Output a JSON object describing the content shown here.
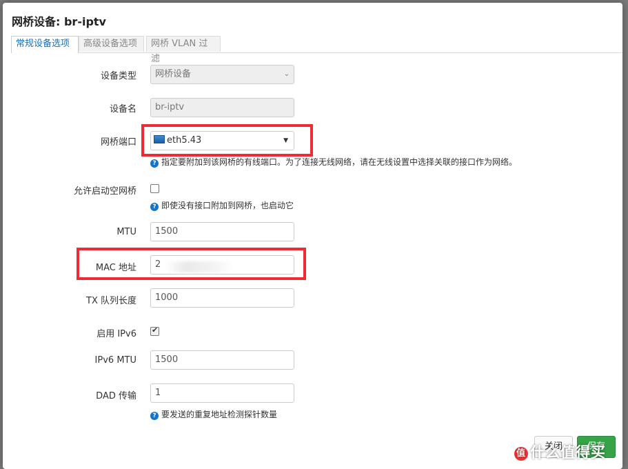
{
  "dialog": {
    "title": "网桥设备: br-iptv"
  },
  "tabs": [
    {
      "label": "常规设备选项",
      "active": true
    },
    {
      "label": "高级设备选项",
      "active": false
    },
    {
      "label": "网桥 VLAN 过滤",
      "active": false
    }
  ],
  "form": {
    "device_type": {
      "label": "设备类型",
      "value": "网桥设备"
    },
    "device_name": {
      "label": "设备名",
      "value": "br-iptv"
    },
    "bridge_ports": {
      "label": "网桥端口",
      "value": "eth5.43",
      "help": "指定要附加到该网桥的有线端口。为了连接无线网络，请在无线设置中选择关联的接口作为网络。"
    },
    "bring_up_empty": {
      "label": "允许启动空网桥",
      "checked": false,
      "help": "即使没有接口附加到网桥，也启动它"
    },
    "mtu": {
      "label": "MTU",
      "value": "1500"
    },
    "mac_address": {
      "label": "MAC 地址",
      "value": "2"
    },
    "tx_queue": {
      "label": "TX 队列长度",
      "value": "1000"
    },
    "enable_ipv6": {
      "label": "启用 IPv6",
      "checked": true
    },
    "ipv6_mtu": {
      "label": "IPv6 MTU",
      "value": "1500"
    },
    "dad_transmits": {
      "label": "DAD 传输",
      "value": "1",
      "help": "要发送的重复地址检测探针数量"
    }
  },
  "footer": {
    "dismiss_label": "关闭",
    "save_label": "保存"
  },
  "watermark": {
    "badge": "值",
    "text": "什么值得买"
  },
  "colors": {
    "accent": "#1a6fb8",
    "highlight_box": "#ee2a33",
    "save_button": "#36a347",
    "help_icon": "#1573c9"
  }
}
